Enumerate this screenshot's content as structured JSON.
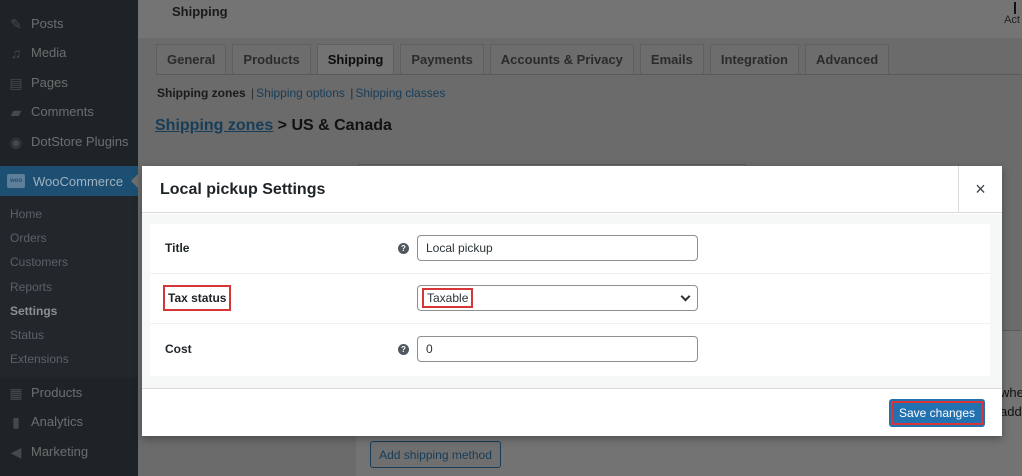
{
  "sidebar": {
    "items": [
      {
        "label": "Posts",
        "icon": "pin-icon"
      },
      {
        "label": "Media",
        "icon": "media-icon"
      },
      {
        "label": "Pages",
        "icon": "page-icon"
      },
      {
        "label": "Comments",
        "icon": "comment-icon"
      },
      {
        "label": "DotStore Plugins",
        "icon": "dotstore-icon"
      }
    ],
    "woocommerce": {
      "label": "WooCommerce",
      "icon_text": "woo"
    },
    "submenu": [
      {
        "label": "Home"
      },
      {
        "label": "Orders"
      },
      {
        "label": "Customers"
      },
      {
        "label": "Reports"
      },
      {
        "label": "Settings"
      },
      {
        "label": "Status"
      },
      {
        "label": "Extensions"
      }
    ],
    "bottom_items": [
      {
        "label": "Products",
        "icon": "archive-icon"
      },
      {
        "label": "Analytics",
        "icon": "analytics-icon"
      },
      {
        "label": "Marketing",
        "icon": "megaphone-icon"
      }
    ]
  },
  "header": {
    "title": "Shipping",
    "right_text": "Act"
  },
  "tabs": [
    {
      "label": "General"
    },
    {
      "label": "Products"
    },
    {
      "label": "Shipping"
    },
    {
      "label": "Payments"
    },
    {
      "label": "Accounts & Privacy"
    },
    {
      "label": "Emails"
    },
    {
      "label": "Integration"
    },
    {
      "label": "Advanced"
    }
  ],
  "subnav": {
    "current": "Shipping zones",
    "sep": "|",
    "options": "Shipping options",
    "classes": "Shipping classes"
  },
  "breadcrumb": {
    "link": "Shipping zones",
    "rest": " > US & Canada"
  },
  "background": {
    "side_text_1": "whe",
    "side_text_2": "addre",
    "add_method": "Add shipping method"
  },
  "modal": {
    "title": "Local pickup Settings",
    "close_glyph": "×",
    "help_glyph": "?",
    "fields": {
      "title": {
        "label": "Title",
        "value": "Local pickup"
      },
      "tax_status": {
        "label": "Tax status",
        "value": "Taxable"
      },
      "cost": {
        "label": "Cost",
        "value": "0"
      }
    },
    "save_label": "Save changes"
  },
  "colors": {
    "accent": "#2271b1",
    "highlight": "#d63638",
    "sidebar": "#1d2327"
  }
}
